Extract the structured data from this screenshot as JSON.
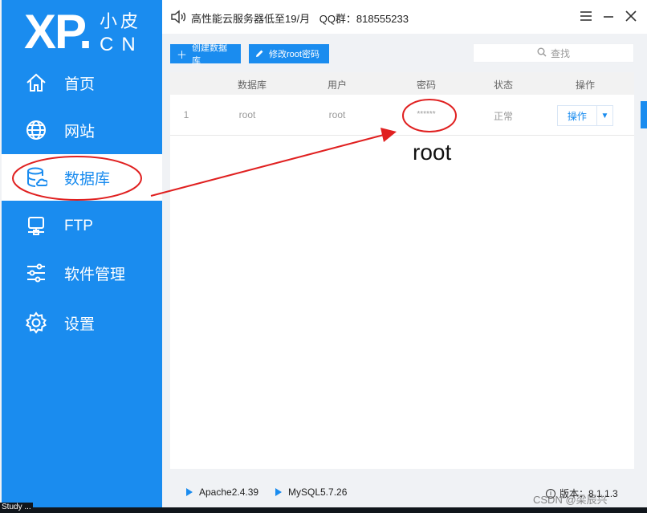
{
  "logo": {
    "main": "XP.",
    "small": "小皮",
    "cn": "CN"
  },
  "sidebar": {
    "items": [
      {
        "label": "首页",
        "icon": "home-icon"
      },
      {
        "label": "网站",
        "icon": "globe-icon"
      },
      {
        "label": "数据库",
        "icon": "database-icon",
        "active": true
      },
      {
        "label": "FTP",
        "icon": "ftp-icon"
      },
      {
        "label": "软件管理",
        "icon": "sliders-icon"
      },
      {
        "label": "设置",
        "icon": "gear-icon"
      }
    ]
  },
  "titlebar": {
    "notice": "高性能云服务器低至19/月",
    "qq": "QQ群：818555233"
  },
  "toolbar": {
    "create_db": "创建数据库",
    "change_pwd": "修改root密码",
    "search_placeholder": "查找"
  },
  "table": {
    "headers": [
      "数据库",
      "用户",
      "密码",
      "状态",
      "操作"
    ],
    "rows": [
      {
        "index": "1",
        "db": "root",
        "user": "root",
        "password": "******",
        "status": "正常",
        "action": "操作"
      }
    ]
  },
  "annotation": {
    "text": "root"
  },
  "status": {
    "apache": "Apache2.4.39",
    "mysql": "MySQL5.7.26",
    "version": "版本：8.1.1.3"
  },
  "taskbar": {
    "fragment": "Study ..."
  },
  "watermark": "CSDN @梁辰兴",
  "colors": {
    "accent": "#1a8cef",
    "annotation": "#e02020"
  }
}
